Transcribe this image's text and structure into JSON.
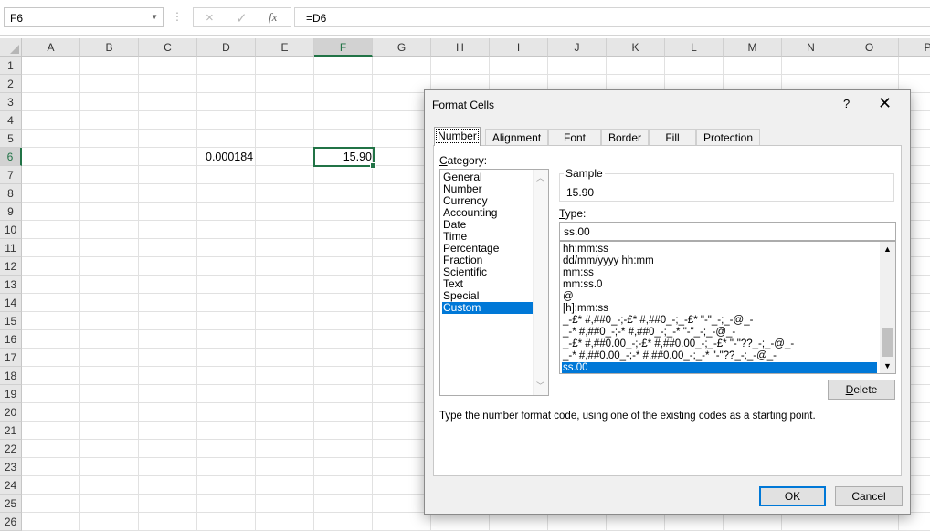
{
  "formula_bar": {
    "name_box": "F6",
    "separator": "⋮",
    "cancel_icon": "×",
    "enter_icon": "✓",
    "fx_icon": "fx",
    "formula": "=D6"
  },
  "sheet": {
    "columns": [
      "A",
      "B",
      "C",
      "D",
      "E",
      "F",
      "G",
      "H",
      "I",
      "J",
      "K",
      "L",
      "M",
      "N",
      "O",
      "P"
    ],
    "rows": [
      "1",
      "2",
      "3",
      "4",
      "5",
      "6",
      "7",
      "8",
      "9",
      "10",
      "11",
      "12",
      "13",
      "14",
      "15",
      "16",
      "17",
      "18",
      "19",
      "20",
      "21",
      "22",
      "23",
      "24",
      "25",
      "26"
    ],
    "selected_column": "F",
    "selected_row": "6",
    "cells": {
      "D6": "0.000184",
      "F6": "15.90"
    }
  },
  "dialog": {
    "title": "Format Cells",
    "help": "?",
    "close": "✕",
    "tabs": [
      "Number",
      "Alignment",
      "Font",
      "Border",
      "Fill",
      "Protection"
    ],
    "active_tab": "Number",
    "category_label_u": "C",
    "category_label_rest": "ategory:",
    "categories": [
      "General",
      "Number",
      "Currency",
      "Accounting",
      "Date",
      "Time",
      "Percentage",
      "Fraction",
      "Scientific",
      "Text",
      "Special",
      "Custom"
    ],
    "selected_category": "Custom",
    "sample_label": "Sample",
    "sample_value": "15.90",
    "type_label_u": "T",
    "type_label_rest": "ype:",
    "type_value": "ss.00",
    "type_list": [
      "hh:mm:ss",
      "dd/mm/yyyy hh:mm",
      "mm:ss",
      "mm:ss.0",
      "@",
      "[h]:mm:ss",
      "_-£* #,##0_-;-£* #,##0_-;_-£* \"-\"_-;_-@_-",
      "_-* #,##0_-;-* #,##0_-;_-* \"-\"_-;_-@_-",
      "_-£* #,##0.00_-;-£* #,##0.00_-;_-£* \"-\"??_-;_-@_-",
      "_-* #,##0.00_-;-* #,##0.00_-;_-* \"-\"??_-;_-@_-",
      "ss.00"
    ],
    "selected_type": "ss.00",
    "delete_u": "D",
    "delete_rest": "elete",
    "description": "Type the number format code, using one of the existing codes as a starting point.",
    "ok": "OK",
    "cancel": "Cancel"
  },
  "colors": {
    "accent_green": "#217346",
    "selection_blue": "#0078d7"
  }
}
